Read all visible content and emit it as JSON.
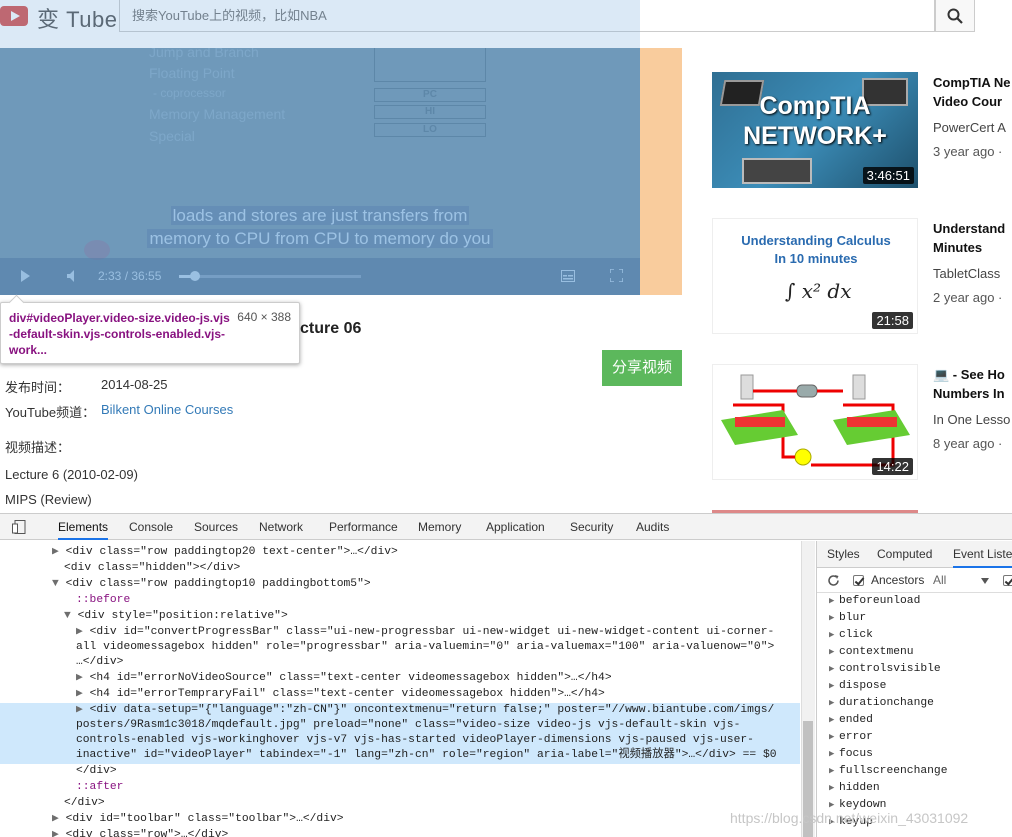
{
  "header": {
    "logo_text": "变 Tube",
    "search_placeholder": "搜索YouTube上的视频，比如NBA"
  },
  "player": {
    "slide_lines": [
      "Jump and Branch",
      "Floating Point",
      "-     coprocessor",
      "Memory Management",
      "Special"
    ],
    "slide_boxes": [
      "PC",
      "HI",
      "LO"
    ],
    "subtitle_lines": [
      "loads and stores are just transfers from",
      "memory to CPU from CPU to memory do you"
    ],
    "time_current": "2:33 / 36:55",
    "progress_fraction": 0.069
  },
  "inspect_tooltip": {
    "selector": "div#videoPlayer.video-size.video-js.vjs-default-skin.vjs-controls-enabled.vjs-work...",
    "size": "640 × 388"
  },
  "video_info": {
    "title_fragment": "cture 06",
    "share_label": "分享视频",
    "publish_label": "发布时间：",
    "publish_date": "2014-08-25",
    "channel_label": "YouTube频道：",
    "channel_name": "Bilkent Online Courses",
    "description_label": "视频描述：",
    "description_lines": [
      "Lecture 6 (2010-02-09)",
      "MIPS (Review)"
    ]
  },
  "recommendations": [
    {
      "title_line1": "CompTIA Ne",
      "title_line2": "Video Cour",
      "channel": "PowerCert A",
      "meta": "3 year ago  ·",
      "duration": "3:46:51",
      "thumb_text1": "CompTIA",
      "thumb_text2": "NETWORK+"
    },
    {
      "title_line1": "Understand",
      "title_line2": "Minutes",
      "channel": "TabletClass",
      "meta": "2 year ago  ·",
      "duration": "21:58",
      "thumb_text1": "Understanding Calculus",
      "thumb_text2": "In 10 minutes"
    },
    {
      "title_line1": "💻 - See Ho",
      "title_line2": "Numbers In",
      "channel": "In One Lesso",
      "meta": "8 year ago  ·",
      "duration": "14:22"
    }
  ],
  "devtools": {
    "tabs": [
      "Elements",
      "Console",
      "Sources",
      "Network",
      "Performance",
      "Memory",
      "Application",
      "Security",
      "Audits"
    ],
    "active_tab": "Elements",
    "side_tabs": [
      "Styles",
      "Computed",
      "Event Listen"
    ],
    "side_active": "Event Listen",
    "ancestors_label": "Ancestors",
    "all_label": "All",
    "events": [
      "beforeunload",
      "blur",
      "click",
      "contextmenu",
      "controlsvisible",
      "dispose",
      "durationchange",
      "ended",
      "error",
      "focus",
      "fullscreenchange",
      "hidden",
      "keydown",
      "keyup"
    ],
    "dom_lines": [
      "<div class=\"row paddingtop20 text-center\">…</div>",
      "<div class=\"hidden\"></div>",
      "<div class=\"row paddingtop10 paddingbottom5\">",
      "::before",
      "<div style=\"position:relative\">",
      "<div id=\"convertProgressBar\" class=\"ui-new-progressbar ui-new-widget ui-new-widget-content ui-corner-",
      "all videomessagebox hidden\" role=\"progressbar\" aria-valuemin=\"0\" aria-valuemax=\"100\" aria-valuenow=\"0\">",
      "…</div>",
      "<h4 id=\"errorNoVideoSource\" class=\"text-center videomessagebox hidden\">…</h4>",
      "<h4 id=\"errorTempraryFail\" class=\"text-center videomessagebox hidden\">…</h4>",
      "<div data-setup=\"{\"language\":\"zh-CN\"}\" oncontextmenu=\"return false;\" poster=\"//www.biantube.com/imgs/",
      "posters/9Rasm1c3018/mqdefault.jpg\" preload=\"none\" class=\"video-size video-js vjs-default-skin vjs-",
      "controls-enabled vjs-workinghover vjs-v7 vjs-has-started videoPlayer-dimensions vjs-paused vjs-user-",
      "inactive\" id=\"videoPlayer\" tabindex=\"-1\" lang=\"zh-cn\" role=\"region\" aria-label=\"视频播放器\">…</div> == $0",
      "</div>",
      "::after",
      "</div>",
      "<div id=\"toolbar\" class=\"toolbar\">…</div>",
      "<div class=\"row\">…</div>"
    ]
  },
  "watermark": "https://blog.csdn.net/weixin_43031092"
}
